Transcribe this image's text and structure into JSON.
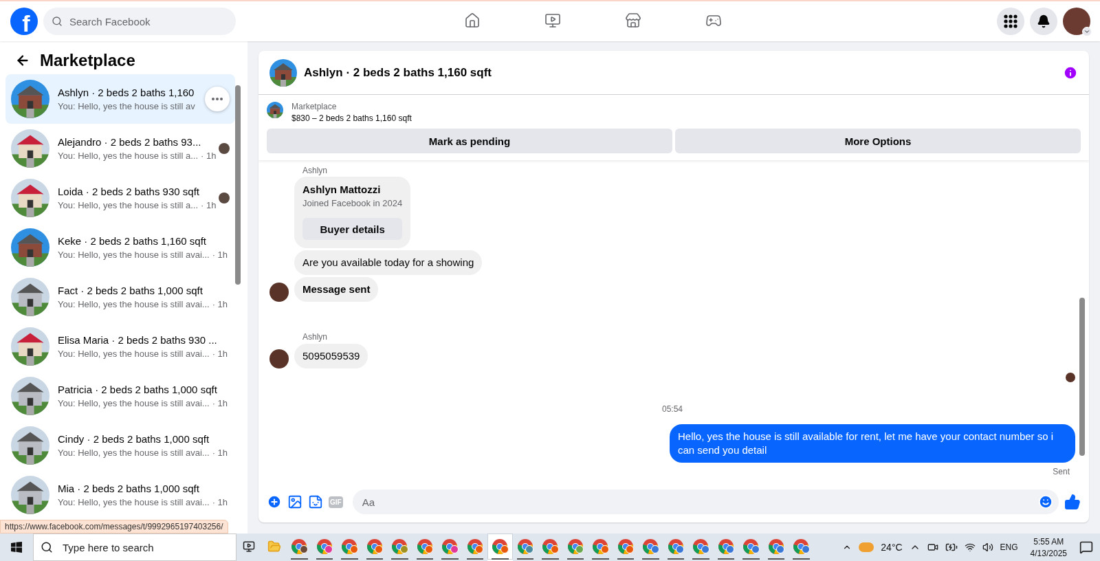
{
  "topbar": {
    "logo": "f",
    "search": {
      "placeholder": "Search Facebook"
    },
    "nav": [
      {
        "kind": "home",
        "selected": false
      },
      {
        "kind": "video",
        "selected": false
      },
      {
        "kind": "store",
        "selected": false
      },
      {
        "kind": "gaming",
        "selected": false
      }
    ]
  },
  "sidebar": {
    "title": "Marketplace",
    "conversations": [
      {
        "title": "Ashlyn · 2 beds 2 baths 1,160",
        "preview": "You: Hello, yes the house is still av",
        "selected": true,
        "seen": false
      },
      {
        "title": "Alejandro · 2 beds 2 baths 93...",
        "preview": "You: Hello, yes the house is still a...",
        "time": "· 1h",
        "selected": false,
        "seen": true
      },
      {
        "title": "Loida · 2 beds 2 baths 930 sqft",
        "preview": "You: Hello, yes the house is still a...",
        "time": "· 1h",
        "selected": false,
        "seen": true
      },
      {
        "title": "Keke · 2 beds 2 baths 1,160 sqft",
        "preview": "You: Hello, yes the house is still avai...",
        "time": "· 1h",
        "selected": false,
        "seen": false
      },
      {
        "title": "Fact · 2 beds 2 baths 1,000 sqft",
        "preview": "You: Hello, yes the house is still avai...",
        "time": "· 1h",
        "selected": false,
        "seen": false
      },
      {
        "title": "Elisa Maria · 2 beds 2 baths 930 ...",
        "preview": "You: Hello, yes the house is still avai...",
        "time": "· 1h",
        "selected": false,
        "seen": false
      },
      {
        "title": "Patricia · 2 beds 2 baths 1,000 sqft",
        "preview": "You: Hello, yes the house is still avai...",
        "time": "· 1h",
        "selected": false,
        "seen": false
      },
      {
        "title": "Cindy · 2 beds 2 baths 1,000 sqft",
        "preview": "You: Hello, yes the house is still avai...",
        "time": "· 1h",
        "selected": false,
        "seen": false
      },
      {
        "title": "Mia · 2 beds 2 baths 1,000 sqft",
        "preview": "You: Hello, yes the house is still avai...",
        "time": "· 1h",
        "selected": false,
        "seen": false
      }
    ]
  },
  "chat": {
    "title": "Ashlyn · 2 beds 2 baths 1,160 sqft",
    "listing": {
      "source": "Marketplace",
      "summary": "$830 – 2 beds 2 baths 1,160 sqft"
    },
    "actions": [
      "Mark as pending",
      "More Options"
    ],
    "messages": [
      {
        "kind": "sender",
        "text": "Ashlyn"
      },
      {
        "kind": "profile",
        "name": "Ashlyn Mattozzi",
        "subtitle": "Joined Facebook in 2024",
        "button": "Buyer details"
      },
      {
        "kind": "incoming",
        "text": "Are you available today for a showing",
        "avatar": false,
        "bold": false
      },
      {
        "kind": "incoming",
        "text": "Message sent",
        "avatar": true,
        "bold": true
      },
      {
        "kind": "sender",
        "text": "Ashlyn"
      },
      {
        "kind": "incoming",
        "text": "5095059539",
        "avatar": true,
        "bold": false
      },
      {
        "kind": "receipt"
      },
      {
        "kind": "timestamp",
        "text": "05:54"
      },
      {
        "kind": "outgoing",
        "text": "Hello, yes the house is still available for rent, let me have your contact number so i can send you detail"
      },
      {
        "kind": "status",
        "text": "Sent"
      }
    ],
    "composer": {
      "placeholder": "Aa",
      "gif": "GIF"
    }
  },
  "status_link": "https://www.facebook.com/messages/t/9992965197403256/",
  "taskbar": {
    "search": {
      "placeholder": "Type here to search"
    },
    "apps": [
      {
        "color": "#6b4a3a",
        "selected": false
      },
      {
        "color": "#e0399a",
        "selected": false
      },
      {
        "color": "#e8590c",
        "selected": false
      },
      {
        "color": "#e8590c",
        "selected": false
      },
      {
        "color": "#a09020",
        "selected": false
      },
      {
        "color": "#e8590c",
        "selected": false
      },
      {
        "color": "#e0399a",
        "selected": false
      },
      {
        "color": "#e8590c",
        "selected": false
      },
      {
        "color": "#e8590c",
        "selected": true
      },
      {
        "color": "#4a8aa0",
        "selected": false
      },
      {
        "color": "#e8590c",
        "selected": false
      },
      {
        "color": "#6aa84f",
        "selected": false
      },
      {
        "color": "#e8590c",
        "selected": false
      },
      {
        "color": "#e8590c",
        "selected": false
      },
      {
        "color": "#3a78d8",
        "selected": false
      },
      {
        "color": "#3a78d8",
        "selected": false
      },
      {
        "color": "#3a78d8",
        "selected": false
      },
      {
        "color": "#3a78d8",
        "selected": false
      },
      {
        "color": "#3a78d8",
        "selected": false
      },
      {
        "color": "#3a78d8",
        "selected": false
      },
      {
        "color": "#3a78d8",
        "selected": false
      }
    ],
    "weather": "24°C",
    "language": "ENG",
    "time": "5:55 AM",
    "date": "4/13/2025"
  }
}
